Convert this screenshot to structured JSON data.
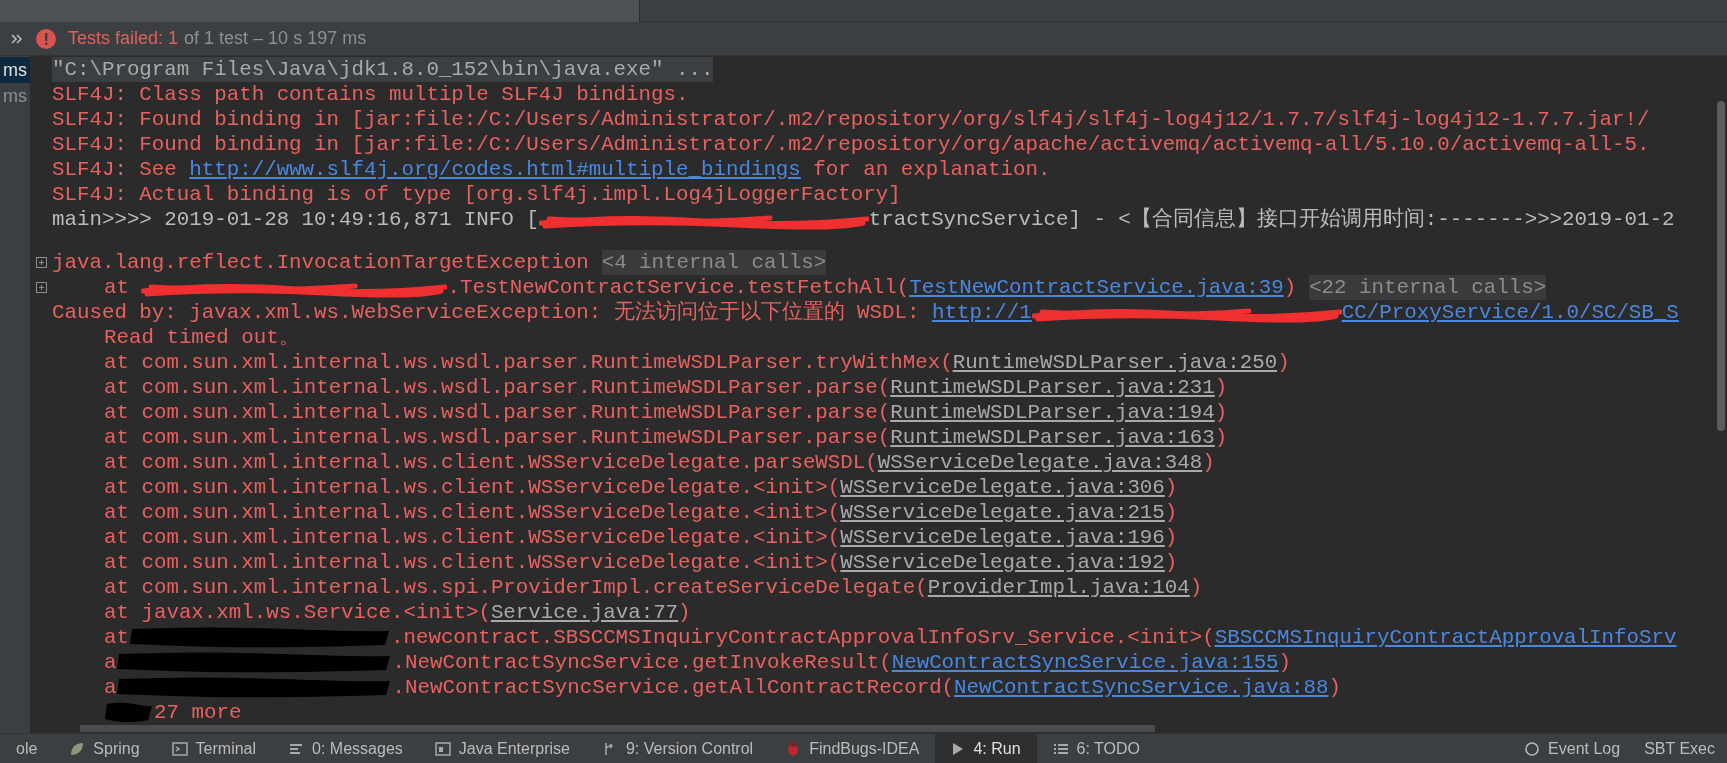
{
  "status": {
    "failed": "Tests failed: 1",
    "summary": "of 1 test – 10 s 197 ms"
  },
  "test_tree": [
    {
      "text": "ms",
      "selected": true
    },
    {
      "text": "ms",
      "selected": false
    }
  ],
  "console": [
    {
      "foldable": false,
      "indented": false,
      "segments": [
        {
          "kind": "command",
          "text": "\"C:\\Program Files\\Java\\jdk1.8.0_152\\bin\\java.exe\" ..."
        }
      ]
    },
    {
      "foldable": false,
      "indented": false,
      "segments": [
        {
          "kind": "error",
          "text": "SLF4J: Class path contains multiple SLF4J bindings."
        }
      ]
    },
    {
      "foldable": false,
      "indented": false,
      "segments": [
        {
          "kind": "error",
          "text": "SLF4J: Found binding in [jar:file:/C:/Users/Administrator/.m2/repository/org/slf4j/slf4j-log4j12/1.7.7/slf4j-log4j12-1.7.7.jar!/"
        }
      ]
    },
    {
      "foldable": false,
      "indented": false,
      "segments": [
        {
          "kind": "error",
          "text": "SLF4J: Found binding in [jar:file:/C:/Users/Administrator/.m2/repository/org/apache/activemq/activemq-all/5.10.0/activemq-all-5."
        }
      ]
    },
    {
      "foldable": false,
      "indented": false,
      "segments": [
        {
          "kind": "error",
          "text": "SLF4J: See "
        },
        {
          "kind": "link",
          "text": "http://www.slf4j.org/codes.html#multiple_bindings"
        },
        {
          "kind": "error",
          "text": " for an explanation."
        }
      ]
    },
    {
      "foldable": false,
      "indented": false,
      "segments": [
        {
          "kind": "error",
          "text": "SLF4J: Actual binding is of type [org.slf4j.impl.Log4jLoggerFactory]"
        }
      ]
    },
    {
      "foldable": false,
      "indented": false,
      "segments": [
        {
          "kind": "plain",
          "text": "main>>>> 2019-01-28 10:49:16,871 INFO ["
        },
        {
          "kind": "scribble",
          "color": "#f03030"
        },
        {
          "kind": "plain",
          "text": "tractSyncService] - <【合同信息】接口开始调用时间:------->>>2019-01-2"
        }
      ]
    },
    {
      "foldable": false
    },
    {
      "foldable": true,
      "indented": false,
      "segments": [
        {
          "kind": "error",
          "text": "java.lang.reflect.InvocationTargetException"
        },
        {
          "kind": "folded",
          "text": "<4 internal calls>"
        }
      ]
    },
    {
      "foldable": true,
      "indented": true,
      "segments": [
        {
          "kind": "error",
          "text": "at "
        },
        {
          "kind": "scribble",
          "color": "#f03030"
        },
        {
          "kind": "error",
          "text": ".TestNewContractService.testFetchAll("
        },
        {
          "kind": "link",
          "text": "TestNewContractService.java:39"
        },
        {
          "kind": "error",
          "text": ")"
        },
        {
          "kind": "folded",
          "text": "<22 internal calls>"
        }
      ]
    },
    {
      "foldable": false,
      "indented": false,
      "segments": [
        {
          "kind": "error",
          "text": "Caused by: javax.xml.ws.WebServiceException: 无法访问位于以下位置的 WSDL: "
        },
        {
          "kind": "link",
          "text": "http://1"
        },
        {
          "kind": "scribble",
          "color": "#f03030"
        },
        {
          "kind": "link",
          "text": "CC/ProxyService/1.0/SC/SB_S"
        }
      ]
    },
    {
      "foldable": false,
      "indented": true,
      "segments": [
        {
          "kind": "error",
          "text": "Read timed out。"
        }
      ]
    },
    {
      "foldable": false,
      "indented": true,
      "segments": [
        {
          "kind": "error",
          "text": "at com.sun.xml.internal.ws.wsdl.parser.RuntimeWSDLParser.tryWithMex("
        },
        {
          "kind": "source",
          "text": "RuntimeWSDLParser.java:250"
        },
        {
          "kind": "error",
          "text": ")"
        }
      ]
    },
    {
      "foldable": false,
      "indented": true,
      "segments": [
        {
          "kind": "error",
          "text": "at com.sun.xml.internal.ws.wsdl.parser.RuntimeWSDLParser.parse("
        },
        {
          "kind": "source",
          "text": "RuntimeWSDLParser.java:231"
        },
        {
          "kind": "error",
          "text": ")"
        }
      ]
    },
    {
      "foldable": false,
      "indented": true,
      "segments": [
        {
          "kind": "error",
          "text": "at com.sun.xml.internal.ws.wsdl.parser.RuntimeWSDLParser.parse("
        },
        {
          "kind": "source",
          "text": "RuntimeWSDLParser.java:194"
        },
        {
          "kind": "error",
          "text": ")"
        }
      ]
    },
    {
      "foldable": false,
      "indented": true,
      "segments": [
        {
          "kind": "error",
          "text": "at com.sun.xml.internal.ws.wsdl.parser.RuntimeWSDLParser.parse("
        },
        {
          "kind": "source",
          "text": "RuntimeWSDLParser.java:163"
        },
        {
          "kind": "error",
          "text": ")"
        }
      ]
    },
    {
      "foldable": false,
      "indented": true,
      "segments": [
        {
          "kind": "error",
          "text": "at com.sun.xml.internal.ws.client.WSServiceDelegate.parseWSDL("
        },
        {
          "kind": "source",
          "text": "WSServiceDelegate.java:348"
        },
        {
          "kind": "error",
          "text": ")"
        }
      ]
    },
    {
      "foldable": false,
      "indented": true,
      "segments": [
        {
          "kind": "error",
          "text": "at com.sun.xml.internal.ws.client.WSServiceDelegate.<init>("
        },
        {
          "kind": "source",
          "text": "WSServiceDelegate.java:306"
        },
        {
          "kind": "error",
          "text": ")"
        }
      ]
    },
    {
      "foldable": false,
      "indented": true,
      "segments": [
        {
          "kind": "error",
          "text": "at com.sun.xml.internal.ws.client.WSServiceDelegate.<init>("
        },
        {
          "kind": "source",
          "text": "WSServiceDelegate.java:215"
        },
        {
          "kind": "error",
          "text": ")"
        }
      ]
    },
    {
      "foldable": false,
      "indented": true,
      "segments": [
        {
          "kind": "error",
          "text": "at com.sun.xml.internal.ws.client.WSServiceDelegate.<init>("
        },
        {
          "kind": "source",
          "text": "WSServiceDelegate.java:196"
        },
        {
          "kind": "error",
          "text": ")"
        }
      ]
    },
    {
      "foldable": false,
      "indented": true,
      "segments": [
        {
          "kind": "error",
          "text": "at com.sun.xml.internal.ws.client.WSServiceDelegate.<init>("
        },
        {
          "kind": "source",
          "text": "WSServiceDelegate.java:192"
        },
        {
          "kind": "error",
          "text": ")"
        }
      ]
    },
    {
      "foldable": false,
      "indented": true,
      "segments": [
        {
          "kind": "error",
          "text": "at com.sun.xml.internal.ws.spi.ProviderImpl.createServiceDelegate("
        },
        {
          "kind": "source",
          "text": "ProviderImpl.java:104"
        },
        {
          "kind": "error",
          "text": ")"
        }
      ]
    },
    {
      "foldable": false,
      "indented": true,
      "segments": [
        {
          "kind": "error",
          "text": "at javax.xml.ws.Service.<init>("
        },
        {
          "kind": "source",
          "text": "Service.java:77"
        },
        {
          "kind": "error",
          "text": ")"
        }
      ]
    },
    {
      "foldable": false,
      "indented": true,
      "segments": [
        {
          "kind": "error",
          "text": "at"
        },
        {
          "kind": "scribble",
          "color": "#000000"
        },
        {
          "kind": "error",
          "text": ".newcontract.SBSCCMSInquiryContractApprovalInfoSrv_Service.<init>("
        },
        {
          "kind": "link",
          "text": "SBSCCMSInquiryContractApprovalInfoSrv"
        }
      ]
    },
    {
      "foldable": false,
      "indented": true,
      "segments": [
        {
          "kind": "error",
          "text": "a"
        },
        {
          "kind": "scribble",
          "color": "#000000"
        },
        {
          "kind": "error",
          "text": ".NewContractSyncService.getInvokeResult("
        },
        {
          "kind": "link",
          "text": "NewContractSyncService.java:155"
        },
        {
          "kind": "error",
          "text": ")"
        }
      ]
    },
    {
      "foldable": false,
      "indented": true,
      "segments": [
        {
          "kind": "error",
          "text": "a"
        },
        {
          "kind": "scribble",
          "color": "#000000"
        },
        {
          "kind": "error",
          "text": ".NewContractSyncService.getAllContractRecord("
        },
        {
          "kind": "link",
          "text": "NewContractSyncService.java:88"
        },
        {
          "kind": "error",
          "text": ")"
        }
      ]
    },
    {
      "foldable": false,
      "indented": true,
      "segments": [
        {
          "kind": "scribble",
          "color": "#000000"
        },
        {
          "kind": "error",
          "text": "27 more"
        }
      ]
    }
  ],
  "tool_windows": [
    {
      "label": "ole",
      "selected": false
    },
    {
      "label": "Spring",
      "selected": false
    },
    {
      "label": "Terminal",
      "selected": false
    },
    {
      "label": "0: Messages",
      "selected": false
    },
    {
      "label": "Java Enterprise",
      "selected": false
    },
    {
      "label": "9: Version Control",
      "selected": false
    },
    {
      "label": "FindBugs-IDEA",
      "selected": false
    },
    {
      "label": "4: Run",
      "selected": true
    },
    {
      "label": "6: TODO",
      "selected": false
    }
  ],
  "tool_windows_right": [
    {
      "label": "Event Log"
    },
    {
      "label": "SBT Exec"
    }
  ]
}
